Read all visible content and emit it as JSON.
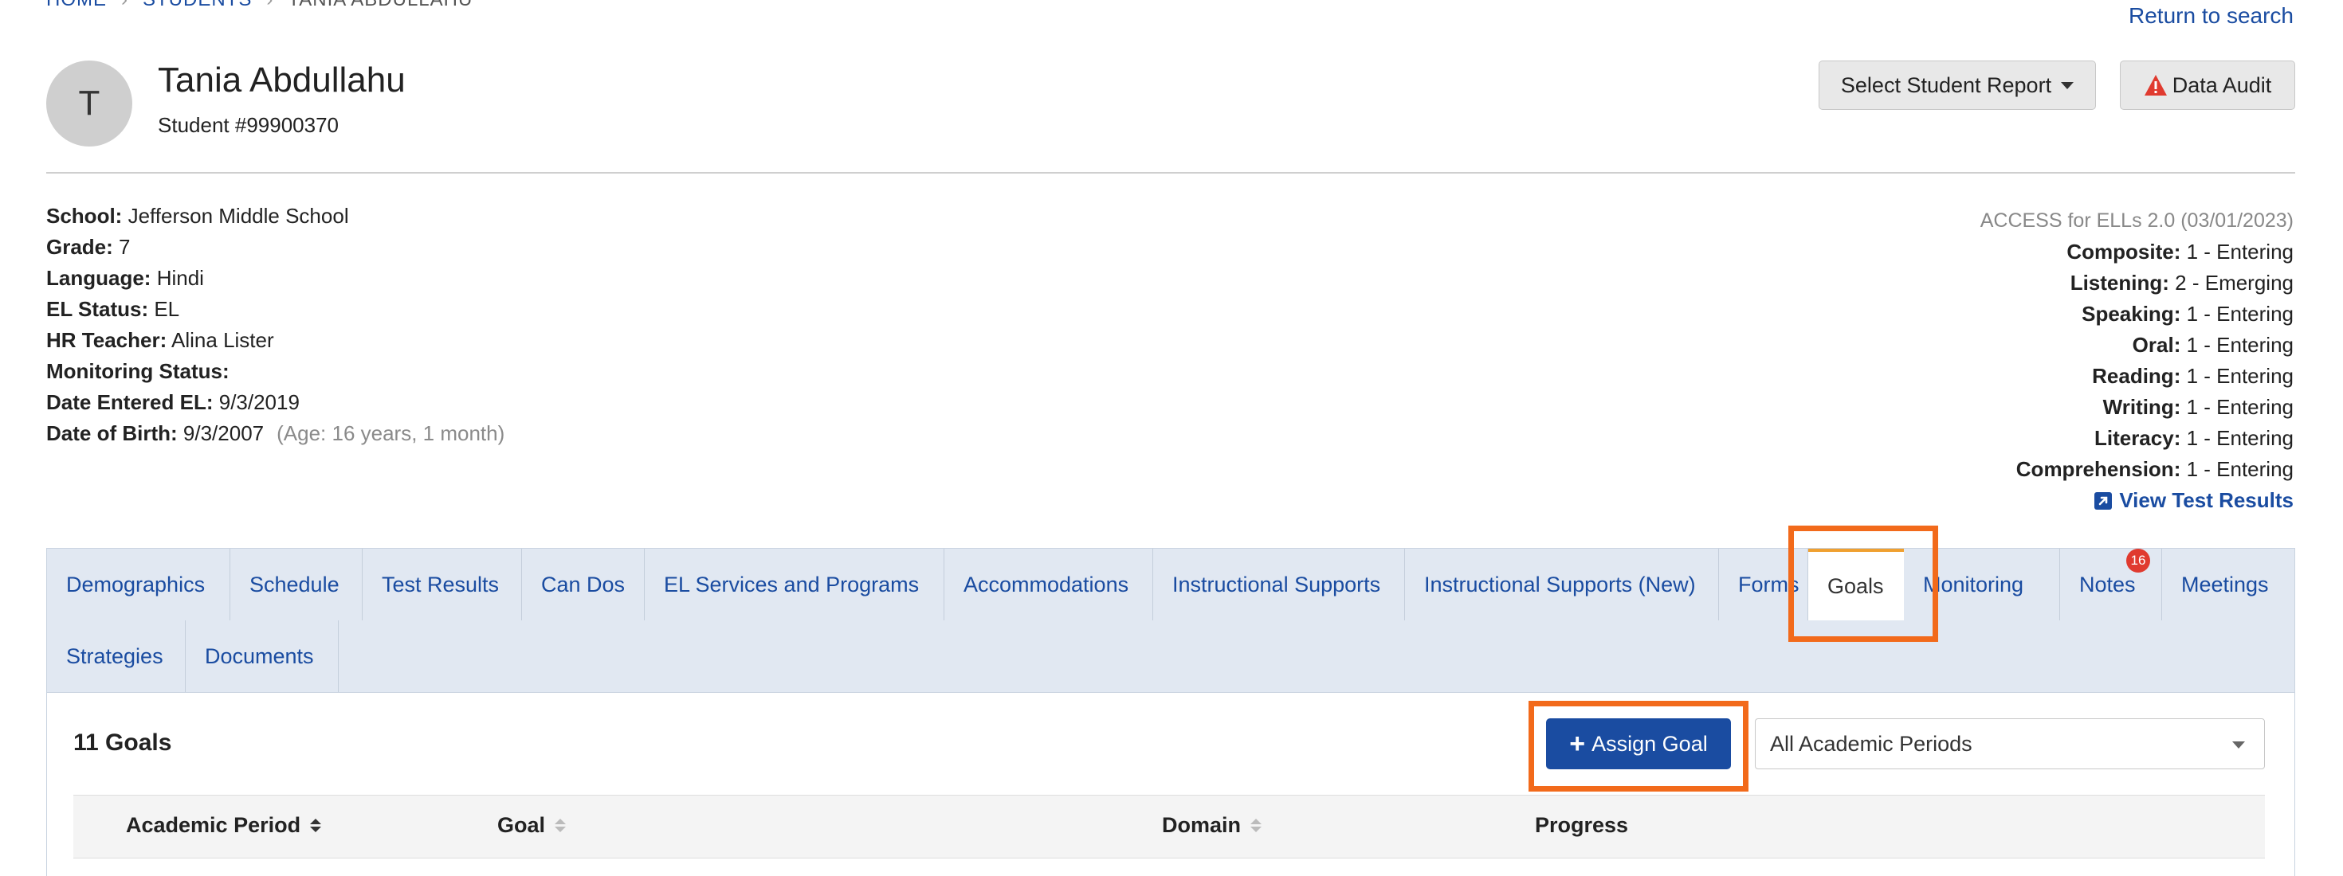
{
  "breadcrumb": {
    "home": "HOME",
    "students": "STUDENTS",
    "current": "TANIA ABDULLAHU"
  },
  "return_link": "Return to search",
  "student": {
    "initial": "T",
    "name": "Tania Abdullahu",
    "number": "Student #99900370"
  },
  "header_buttons": {
    "report": "Select Student Report",
    "audit": "Data Audit"
  },
  "info": {
    "school_label": "School:",
    "school": "Jefferson Middle School",
    "grade_label": "Grade:",
    "grade": "7",
    "language_label": "Language:",
    "language": "Hindi",
    "el_status_label": "EL Status:",
    "el_status": "EL",
    "hr_teacher_label": "HR Teacher:",
    "hr_teacher": "Alina Lister",
    "monitoring_label": "Monitoring Status:",
    "monitoring": "",
    "date_entered_label": "Date Entered EL:",
    "date_entered": "9/3/2019",
    "dob_label": "Date of Birth:",
    "dob": "9/3/2007",
    "age": "(Age: 16 years, 1 month)"
  },
  "scores": {
    "title": "ACCESS for ELLs 2.0 (03/01/2023)",
    "rows": [
      {
        "label": "Composite:",
        "value": "1 - Entering"
      },
      {
        "label": "Listening:",
        "value": "2 - Emerging"
      },
      {
        "label": "Speaking:",
        "value": "1 - Entering"
      },
      {
        "label": "Oral:",
        "value": "1 - Entering"
      },
      {
        "label": "Reading:",
        "value": "1 - Entering"
      },
      {
        "label": "Writing:",
        "value": "1 - Entering"
      },
      {
        "label": "Literacy:",
        "value": "1 - Entering"
      },
      {
        "label": "Comprehension:",
        "value": "1 - Entering"
      }
    ],
    "view_link": "View Test Results"
  },
  "tabs": [
    "Demographics",
    "Schedule",
    "Test Results",
    "Can Dos",
    "EL Services and Programs",
    "Accommodations",
    "Instructional Supports",
    "Instructional Supports (New)",
    "Forms",
    "Goals",
    "Monitoring",
    "Notes",
    "Meetings",
    "Strategies",
    "Documents"
  ],
  "notes_badge": "16",
  "goals": {
    "count": "11 Goals",
    "assign_label": "Assign Goal",
    "period_select": "All Academic Periods",
    "columns": [
      "Academic Period",
      "Goal",
      "Domain",
      "Progress"
    ]
  },
  "colors": {
    "accent": "#1a4ca1",
    "highlight": "#f26a1b",
    "tab_active_border": "#f0a030",
    "badge": "#e03a2f"
  }
}
